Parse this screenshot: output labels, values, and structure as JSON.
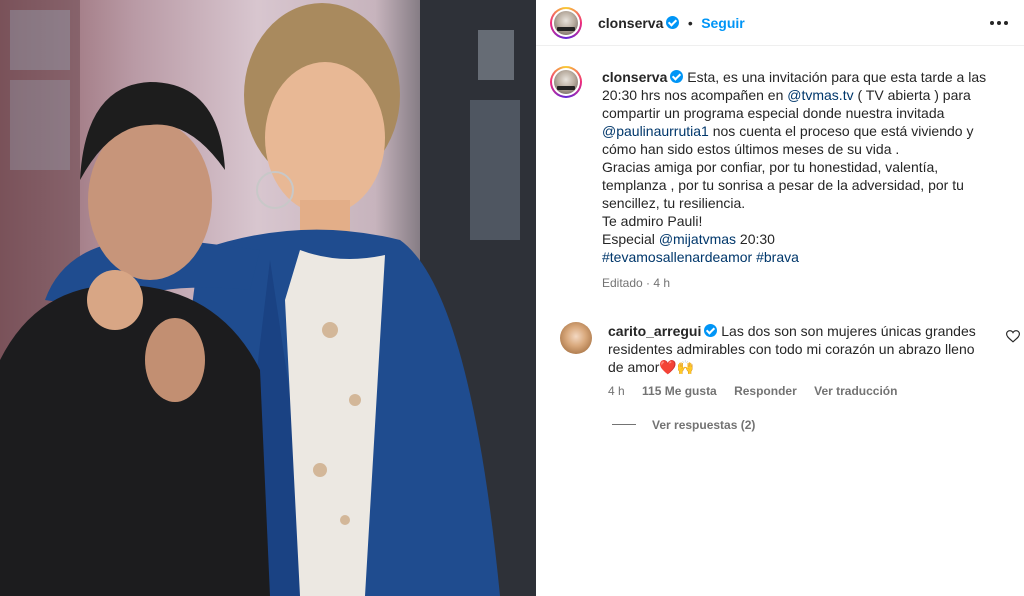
{
  "post": {
    "username": "clonserva",
    "follow_label": "Seguir",
    "caption": {
      "intro": "Esta, es una invitación para que esta tarde a las 20:30 hrs nos acompañen en",
      "mention1": "@tvmas.tv",
      "part2": "( TV abierta ) para compartir un programa especial donde nuestra invitada",
      "mention2": "@paulinaurrutia1",
      "part3": "nos cuenta el proceso que está viviendo y cómo han sido estos últimos meses de su vida .",
      "line2": "Gracias amiga por confiar, por tu honestidad, valentía, templanza , por tu sonrisa a pesar de la adversidad, por tu sencillez, tu resiliencia.",
      "line3": "Te admiro Pauli!",
      "line4_prefix": "Especial",
      "mention3": "@mijatvmas",
      "line4_suffix": "20:30",
      "hashtag1": "#tevamosallenardeamor",
      "hashtag2": "#brava"
    },
    "edited_label": "Editado",
    "time": "4 h"
  },
  "comment": {
    "username": "carito_arregui",
    "text": "Las dos son son mujeres únicas grandes residentes admirables con todo mi corazón un abrazo lleno de amor",
    "emojis": "❤️🙌",
    "time": "4 h",
    "likes": "115 Me gusta",
    "reply_label": "Responder",
    "translate_label": "Ver traducción",
    "view_replies": "Ver respuestas (2)"
  },
  "icons": {
    "more": "more-options-icon",
    "verified": "verified-badge-icon",
    "heart": "heart-outline-icon"
  },
  "colors": {
    "link": "#00376b",
    "follow": "#0095f6",
    "verified": "#0095f6",
    "muted": "#737373"
  }
}
